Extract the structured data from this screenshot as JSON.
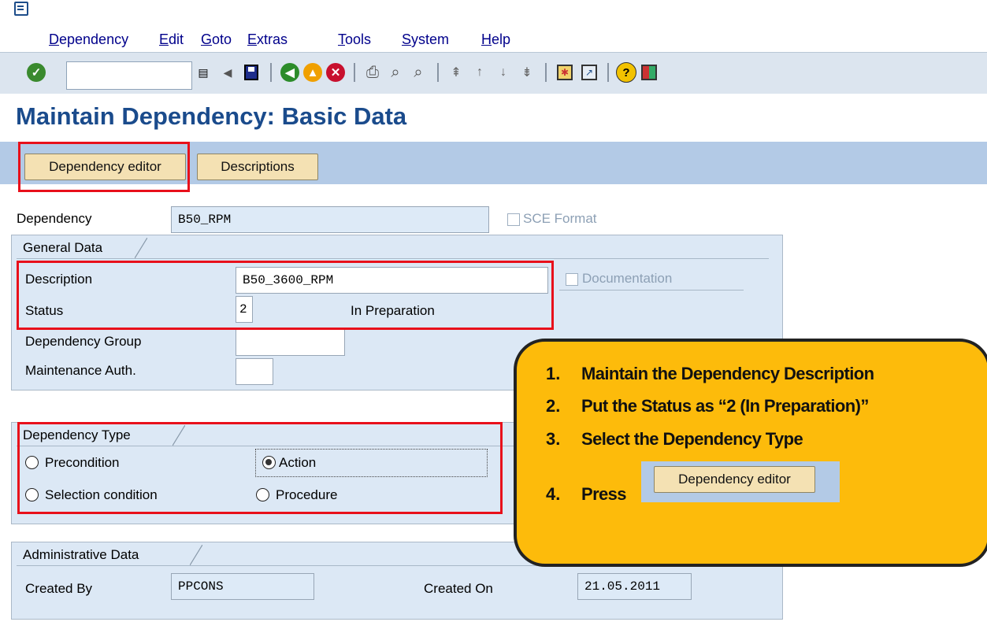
{
  "menu": {
    "items": [
      {
        "label": "Dependency"
      },
      {
        "label": "Edit"
      },
      {
        "label": "Goto"
      },
      {
        "label": "Extras"
      },
      {
        "label": "Tools"
      },
      {
        "label": "System"
      },
      {
        "label": "Help"
      }
    ]
  },
  "toolbar": {
    "command_field_value": ""
  },
  "page": {
    "title": "Maintain Dependency: Basic Data"
  },
  "app_toolbar": {
    "dependency_editor_label": "Dependency editor",
    "descriptions_label": "Descriptions"
  },
  "header": {
    "dependency_label": "Dependency",
    "dependency_value": "B50_RPM",
    "sce_format_label": "SCE Format"
  },
  "general_data": {
    "title": "General Data",
    "description_label": "Description",
    "description_value": "B50_3600_RPM",
    "documentation_label": "Documentation",
    "status_label": "Status",
    "status_value": "2",
    "status_text": "In Preparation",
    "dependency_group_label": "Dependency Group",
    "dependency_group_value": "",
    "maintenance_auth_label": "Maintenance Auth.",
    "maintenance_auth_value": ""
  },
  "dependency_type": {
    "title": "Dependency Type",
    "options": [
      {
        "label": "Precondition",
        "selected": false
      },
      {
        "label": "Action",
        "selected": true
      },
      {
        "label": "Selection condition",
        "selected": false
      },
      {
        "label": "Procedure",
        "selected": false
      }
    ]
  },
  "administrative_data": {
    "title": "Administrative Data",
    "created_by_label": "Created By",
    "created_by_value": "PPCONS",
    "created_on_label": "Created On",
    "created_on_value": "21.05.2011"
  },
  "callout": {
    "steps": [
      {
        "num": "1.",
        "text": "Maintain the Dependency Description"
      },
      {
        "num": "2.",
        "text": "Put the Status as “2 (In Preparation)”"
      },
      {
        "num": "3.",
        "text": "Select the Dependency Type"
      },
      {
        "num": "4.",
        "text": "Press"
      }
    ],
    "button_label": "Dependency editor"
  },
  "colors": {
    "title_blue": "#1a4b8c",
    "highlight_red": "#e8101b",
    "callout_yellow": "#fdbb0b",
    "sap_button": "#f4e1b3"
  }
}
